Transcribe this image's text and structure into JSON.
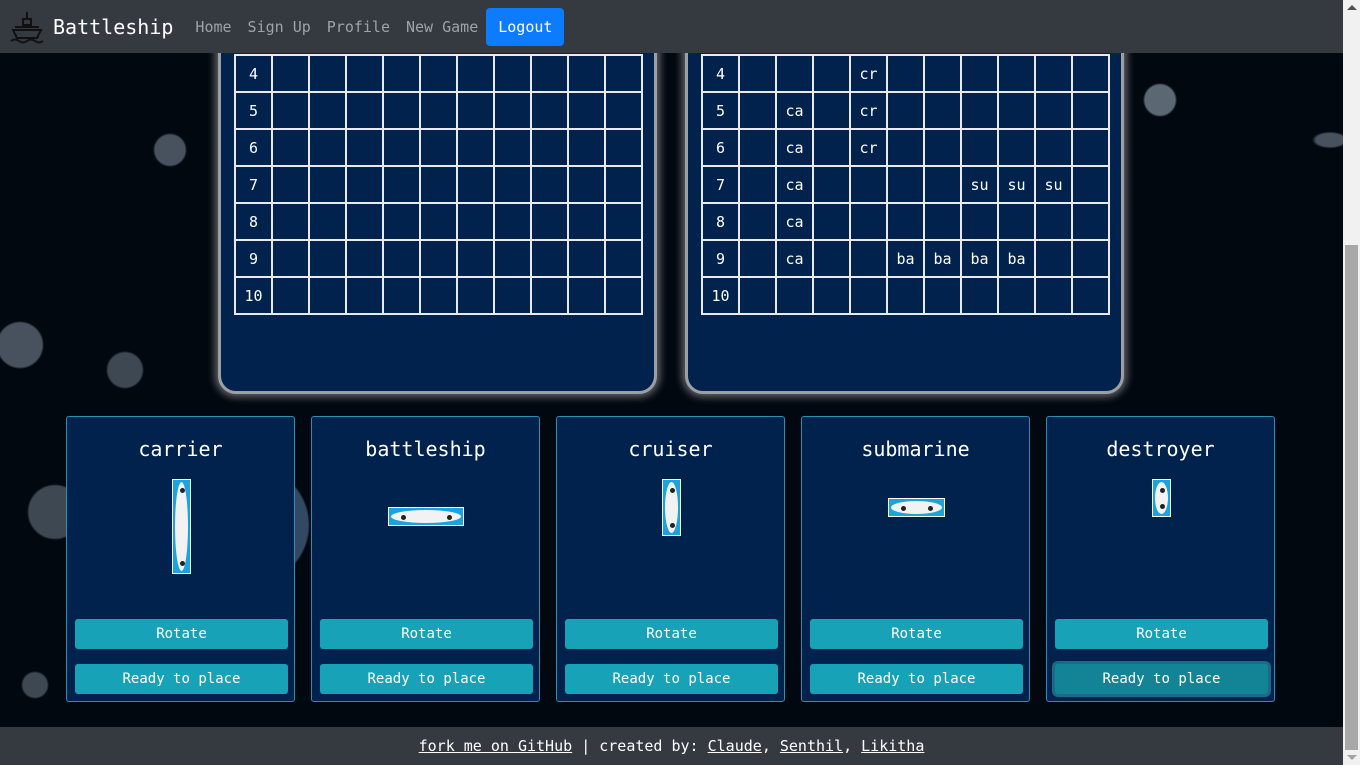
{
  "navbar": {
    "brand_icon": "ship-icon",
    "brand": "Battleship",
    "links": [
      "Home",
      "Sign Up",
      "Profile",
      "New Game"
    ],
    "logout": "Logout"
  },
  "boards": {
    "opponent": {
      "rows": [
        {
          "label": "4",
          "cells": [
            "",
            "",
            "",
            "",
            "",
            "",
            "",
            "",
            "",
            ""
          ]
        },
        {
          "label": "5",
          "cells": [
            "",
            "",
            "",
            "",
            "",
            "",
            "",
            "",
            "",
            ""
          ]
        },
        {
          "label": "6",
          "cells": [
            "",
            "",
            "",
            "",
            "",
            "",
            "",
            "",
            "",
            ""
          ]
        },
        {
          "label": "7",
          "cells": [
            "",
            "",
            "",
            "",
            "",
            "",
            "",
            "",
            "",
            ""
          ]
        },
        {
          "label": "8",
          "cells": [
            "",
            "",
            "",
            "",
            "",
            "",
            "",
            "",
            "",
            ""
          ]
        },
        {
          "label": "9",
          "cells": [
            "",
            "",
            "",
            "",
            "",
            "",
            "",
            "",
            "",
            ""
          ]
        },
        {
          "label": "10",
          "cells": [
            "",
            "",
            "",
            "",
            "",
            "",
            "",
            "",
            "",
            ""
          ]
        }
      ]
    },
    "player": {
      "rows": [
        {
          "label": "4",
          "cells": [
            "",
            "",
            "",
            "cr",
            "",
            "",
            "",
            "",
            "",
            ""
          ]
        },
        {
          "label": "5",
          "cells": [
            "",
            "ca",
            "",
            "cr",
            "",
            "",
            "",
            "",
            "",
            ""
          ]
        },
        {
          "label": "6",
          "cells": [
            "",
            "ca",
            "",
            "cr",
            "",
            "",
            "",
            "",
            "",
            ""
          ]
        },
        {
          "label": "7",
          "cells": [
            "",
            "ca",
            "",
            "",
            "",
            "",
            "su",
            "su",
            "su",
            ""
          ]
        },
        {
          "label": "8",
          "cells": [
            "",
            "ca",
            "",
            "",
            "",
            "",
            "",
            "",
            "",
            ""
          ]
        },
        {
          "label": "9",
          "cells": [
            "",
            "ca",
            "",
            "",
            "ba",
            "ba",
            "ba",
            "ba",
            "",
            ""
          ]
        },
        {
          "label": "10",
          "cells": [
            "",
            "",
            "",
            "",
            "",
            "",
            "",
            "",
            "",
            ""
          ]
        }
      ]
    }
  },
  "ships": [
    {
      "name": "carrier",
      "orientation": "vertical",
      "length": 5,
      "rotate_label": "Rotate",
      "ready_label": "Ready to place"
    },
    {
      "name": "battleship",
      "orientation": "horizontal",
      "length": 4,
      "rotate_label": "Rotate",
      "ready_label": "Ready to place"
    },
    {
      "name": "cruiser",
      "orientation": "vertical",
      "length": 3,
      "rotate_label": "Rotate",
      "ready_label": "Ready to place"
    },
    {
      "name": "submarine",
      "orientation": "horizontal",
      "length": 3,
      "rotate_label": "Rotate",
      "ready_label": "Ready to place"
    },
    {
      "name": "destroyer",
      "orientation": "vertical",
      "length": 2,
      "rotate_label": "Rotate",
      "ready_label": "Ready to place",
      "focused": true
    }
  ],
  "footer": {
    "github": "fork me on GitHub",
    "separator": "|",
    "created_by": "created by:",
    "authors": [
      "Claude",
      "Senthil",
      "Likitha"
    ]
  }
}
